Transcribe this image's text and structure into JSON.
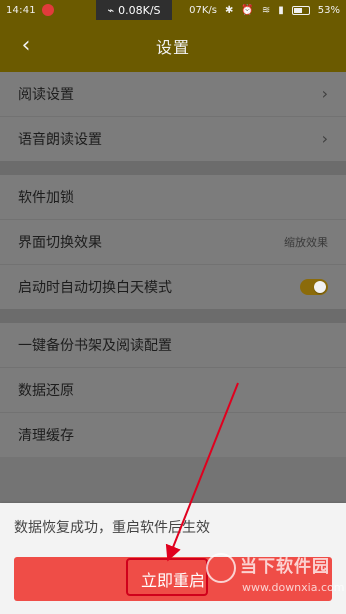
{
  "status_bar": {
    "time": "14:41",
    "net_speed_main": "0.08K/S",
    "net_speed_secondary": "07K/s",
    "battery": "53%",
    "icons": [
      "netease-cloud-music-icon",
      "wifi-icon",
      "bluetooth-icon",
      "alarm-icon",
      "wifi-signal-icon",
      "cellular-signal-icon",
      "battery-icon"
    ]
  },
  "app_bar": {
    "title": "设置",
    "back_icon": "chevron-left-icon"
  },
  "settings": {
    "section1": [
      {
        "label": "阅读设置",
        "has_chevron": true
      },
      {
        "label": "语音朗读设置",
        "has_chevron": true
      }
    ],
    "section2": [
      {
        "label": "软件加锁"
      },
      {
        "label": "界面切换效果",
        "value": "缩放效果"
      },
      {
        "label": "启动时自动切换白天模式",
        "toggle": true
      }
    ],
    "section3": [
      {
        "label": "一键备份书架及阅读配置"
      },
      {
        "label": "数据还原"
      },
      {
        "label": "清理缓存"
      }
    ]
  },
  "dialog": {
    "message": "数据恢复成功，重启软件后生效",
    "button_label": "立即重启"
  },
  "watermark": {
    "title": "当下软件园",
    "url": "www.downxia.com"
  },
  "colors": {
    "app_bar": "#6b5a00",
    "button_red": "#ef4d47",
    "highlight_red": "#d0001b"
  }
}
